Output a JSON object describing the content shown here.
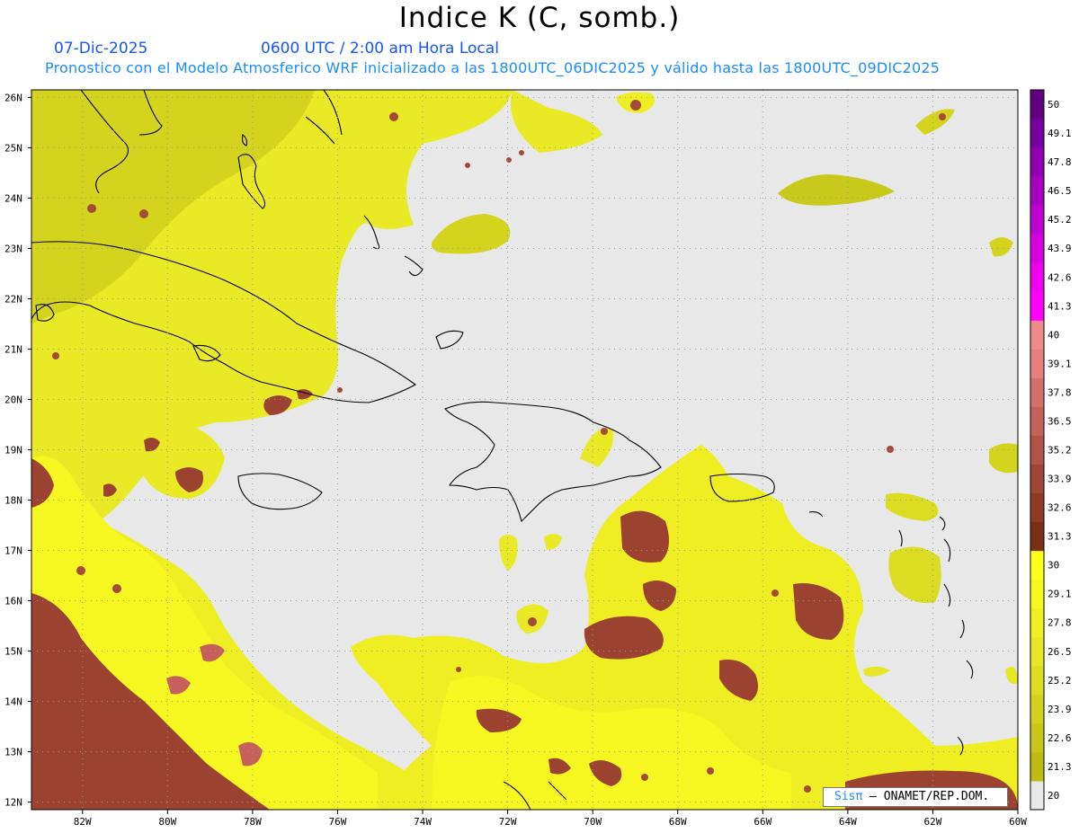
{
  "header": {
    "title": "Indice K (C, somb.)",
    "date": "07-Dic-2025",
    "time": "0600 UTC / 2:00 am Hora Local",
    "description": "Pronostico con el Modelo Atmosferico WRF inicializado a las 1800UTC_06DIC2025 y válido hasta las  1800UTC_09DIC2025"
  },
  "map": {
    "projection": "lat-lon",
    "lon_range": [
      -83.2,
      -60
    ],
    "lat_range": [
      11.85,
      26.15
    ],
    "lon_labels": [
      "82W",
      "80W",
      "78W",
      "76W",
      "74W",
      "72W",
      "70W",
      "68W",
      "66W",
      "64W",
      "62W",
      "60W"
    ],
    "lat_labels": [
      "12N",
      "13N",
      "14N",
      "15N",
      "16N",
      "17N",
      "18N",
      "19N",
      "20N",
      "21N",
      "22N",
      "23N",
      "24N",
      "25N",
      "26N"
    ],
    "background_color": "#e8e8e8",
    "grid": "dotted"
  },
  "colorbar": {
    "levels": [
      "20",
      "21.3",
      "22.6",
      "23.9",
      "25.2",
      "26.5",
      "27.8",
      "29.1",
      "30",
      "31.3",
      "32.6",
      "33.9",
      "35.2",
      "36.5",
      "37.8",
      "39.1",
      "40",
      "41.3",
      "42.6",
      "43.9",
      "45.2",
      "46.5",
      "47.8",
      "49.1",
      "50"
    ],
    "colors": [
      "#e8e8e8",
      "#bcbc14",
      "#c7c71a",
      "#d2d21e",
      "#dcdc22",
      "#e6e626",
      "#eeee22",
      "#f6f620",
      "#ffff1a",
      "#7a2e16",
      "#8c3a22",
      "#9e4634",
      "#b05446",
      "#c26258",
      "#d4706a",
      "#e67e7c",
      "#f08a88",
      "#ff00ff",
      "#f000f0",
      "#d800e0",
      "#c000d0",
      "#a800c0",
      "#9000b0",
      "#7800a0",
      "#600080"
    ]
  },
  "credit": {
    "brand": "Sisπ",
    "text": " – ONAMET/REP.DOM."
  }
}
